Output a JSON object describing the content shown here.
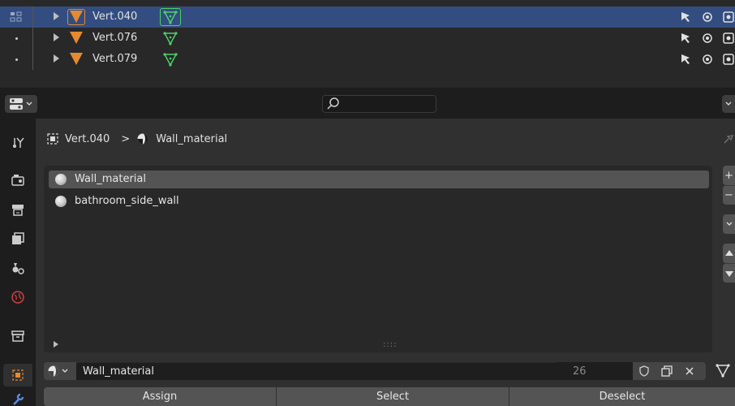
{
  "outliner": {
    "rows": [
      {
        "name": "Vert.040",
        "selected": true
      },
      {
        "name": "Vert.076",
        "selected": false
      },
      {
        "name": "Vert.079",
        "selected": false
      }
    ]
  },
  "header": {
    "search_placeholder": ""
  },
  "breadcrumb": {
    "object": "Vert.040",
    "separator": ">",
    "material": "Wall_material"
  },
  "material_slots": {
    "items": [
      {
        "label": "Wall_material",
        "selected": true
      },
      {
        "label": "bathroom_side_wall",
        "selected": false
      }
    ],
    "grip": "::::"
  },
  "side_buttons": {
    "add": "+",
    "remove": "−"
  },
  "material_selector": {
    "name": "Wall_material",
    "users": "26"
  },
  "actions": {
    "assign": "Assign",
    "select": "Select",
    "deselect": "Deselect"
  },
  "colors": {
    "selection_blue": "#334d80",
    "mesh_orange": "#e58a30",
    "vertex_green": "#4cd16b",
    "panel_bg": "#303030"
  }
}
